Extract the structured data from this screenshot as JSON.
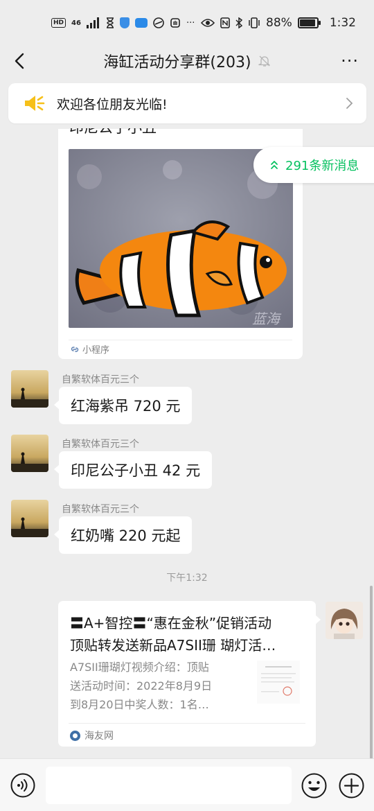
{
  "status_bar": {
    "hd": "HD",
    "network": "46",
    "battery_pct": "88%",
    "battery_level": 0.88,
    "time": "1:32",
    "more_dots": "···"
  },
  "header": {
    "title": "海缸活动分享群(203)",
    "more_label": "···"
  },
  "notice": {
    "text": "欢迎各位朋友光临!"
  },
  "mini_card": {
    "title_cut": "印尼公子小丑",
    "watermark": "蓝海",
    "label": "小程序"
  },
  "new_msg_pill": {
    "text": "291条新消息"
  },
  "messages": [
    {
      "sender": "自繁软体百元三个",
      "text": "红海紫吊 720 元"
    },
    {
      "sender": "自繁软体百元三个",
      "text": "印尼公子小丑 42 元"
    },
    {
      "sender": "自繁软体百元三个",
      "text": "红奶嘴 220 元起"
    }
  ],
  "timestamp": "下午1:32",
  "link_card": {
    "title_line1": "〓A+智控〓“惠在金秋”促销活动",
    "title_line2": "顶贴转发送新品A7SII珊 瑚灯活…",
    "desc_line1": "A7SII珊瑚灯视频介绍：顶贴",
    "desc_line2": "送活动时间：2022年8月9日",
    "desc_line3": "到8月20日中奖人数：1名…",
    "source": "海友网"
  },
  "input_bar": {
    "placeholder": ""
  },
  "colors": {
    "accent_green": "#07c160",
    "background": "#ededed",
    "bubble": "#ffffff",
    "notice_icon": "#f6c01a"
  },
  "icons": {
    "back": "chevron-left-icon",
    "mute": "bell-off-icon",
    "notice": "speaker-icon",
    "new_msg": "double-chevron-up-icon",
    "voice": "voice-icon",
    "emoji": "emoji-icon",
    "plus": "plus-circle-icon"
  }
}
